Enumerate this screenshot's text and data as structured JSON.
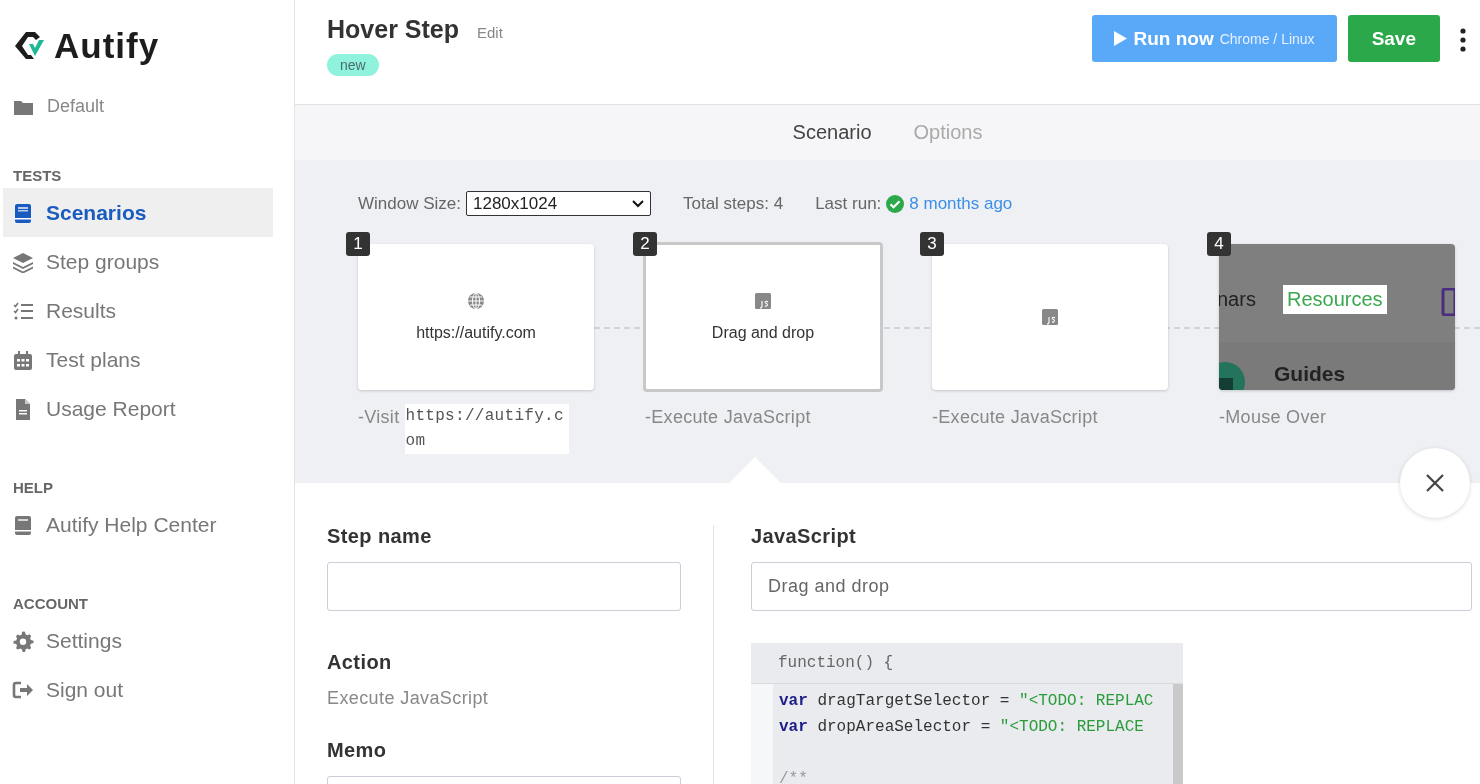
{
  "sidebar": {
    "logo": "Autify",
    "folder": "Default",
    "sections": [
      {
        "title": "TESTS",
        "items": [
          {
            "label": "Scenarios",
            "selected": true
          },
          {
            "label": "Step groups",
            "selected": false
          },
          {
            "label": "Results",
            "selected": false
          },
          {
            "label": "Test plans",
            "selected": false
          },
          {
            "label": "Usage Report",
            "selected": false
          }
        ]
      },
      {
        "title": "HELP",
        "items": [
          {
            "label": "Autify Help Center",
            "selected": false
          }
        ]
      },
      {
        "title": "ACCOUNT",
        "items": [
          {
            "label": "Settings",
            "selected": false
          },
          {
            "label": "Sign out",
            "selected": false
          }
        ]
      }
    ]
  },
  "header": {
    "title": "Hover Step",
    "edit": "Edit",
    "badge": "new",
    "run_label": "Run now",
    "run_target": "Chrome / Linux",
    "save": "Save"
  },
  "tabs": [
    {
      "label": "Scenario",
      "selected": true
    },
    {
      "label": "Options",
      "selected": false
    }
  ],
  "toolbar": {
    "window_size_label": "Window Size:",
    "window_size": "1280x1024",
    "total_steps": "Total steps: 4",
    "last_run_label": "Last run:",
    "last_run": "8 months ago"
  },
  "steps": [
    {
      "number": "1",
      "kind": "visit",
      "title": "https://autify.com",
      "caption": "-Visit",
      "caption_code": "https://autify.com",
      "selected": false
    },
    {
      "number": "2",
      "kind": "javascript",
      "title": "Drag and drop",
      "caption": "-Execute JavaScript",
      "selected": true
    },
    {
      "number": "3",
      "kind": "javascript",
      "caption": "-Execute JavaScript",
      "selected": false
    },
    {
      "number": "4",
      "kind": "screenshot",
      "caption": "-Mouse Over",
      "selected": false,
      "screenshot": {
        "menu_item": "nars",
        "active_item": "Resources",
        "heading": "Guides"
      }
    }
  ],
  "detail": {
    "step_name_label": "Step name",
    "action_label": "Action",
    "action": "Execute JavaScript",
    "memo_label": "Memo",
    "script_label": "JavaScript",
    "script_name": "Drag and drop",
    "code_header": "function() {",
    "code_lines": [
      {
        "kind": "code",
        "tokens": [
          {
            "kind": "keyword",
            "text": "var"
          },
          {
            "kind": "plain",
            "text": " dragTargetSelector = "
          },
          {
            "kind": "string",
            "text": "\"<TODO: REPLAC"
          }
        ]
      },
      {
        "kind": "code",
        "tokens": [
          {
            "kind": "keyword",
            "text": "var"
          },
          {
            "kind": "plain",
            "text": " dropAreaSelector = "
          },
          {
            "kind": "string",
            "text": "\"<TODO: REPLACE"
          }
        ]
      },
      {
        "kind": "blank"
      },
      {
        "kind": "code",
        "tokens": [
          {
            "kind": "comment",
            "text": "/**"
          }
        ]
      }
    ]
  }
}
